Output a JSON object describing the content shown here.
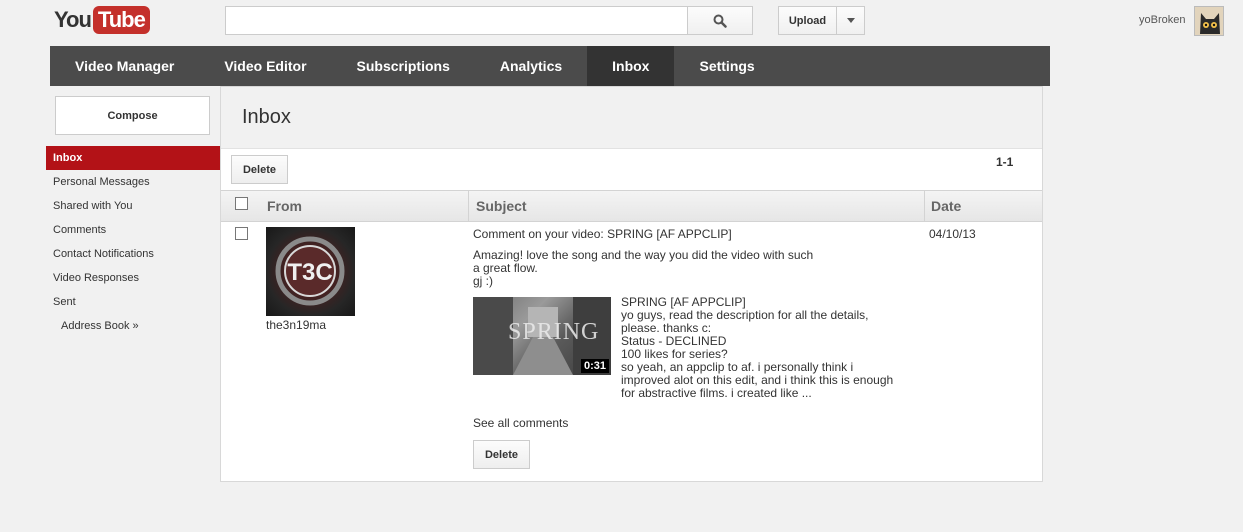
{
  "header": {
    "logo_you": "You",
    "logo_tube": "Tube",
    "search_value": "",
    "upload_label": "Upload",
    "username": "yoBroken",
    "search_icon": "search-icon",
    "dropdown_icon": "caret-down-icon"
  },
  "nav": {
    "items": [
      "Video Manager",
      "Video Editor",
      "Subscriptions",
      "Analytics",
      "Inbox",
      "Settings"
    ],
    "active": "Inbox"
  },
  "sidebar": {
    "compose_label": "Compose",
    "items": [
      "Inbox",
      "Personal Messages",
      "Shared with You",
      "Comments",
      "Contact Notifications",
      "Video Responses",
      "Sent",
      "Address Book »"
    ],
    "active": "Inbox"
  },
  "main": {
    "title": "Inbox",
    "delete_label": "Delete",
    "page_count": "1-1",
    "columns": {
      "from": "From",
      "subject": "Subject",
      "date": "Date"
    },
    "messages": [
      {
        "from": "the3n19ma",
        "avatar_text": "T3C",
        "subject": "Comment on your video: SPRING [AF APPCLIP]",
        "body": [
          "Amazing! love the song and the way you did the video with such",
          "a great flow.",
          "gj :)"
        ],
        "video": {
          "thumb_text": "SPRING",
          "duration": "0:31",
          "title": "SPRING [AF APPCLIP]",
          "description": [
            "yo guys, read the description for all the details,",
            "please. thanks c:",
            "Status - DECLINED",
            "100 likes for series?",
            "so yeah, an appclip to af. i personally think i",
            "improved alot on this edit, and i think this is enough",
            "for abstractive films. i created like ..."
          ]
        },
        "see_all": "See all comments",
        "delete_label": "Delete",
        "date": "04/10/13"
      }
    ]
  },
  "colors": {
    "nav_bg": "#4b4b4b",
    "nav_active": "#333333",
    "sidebar_active": "#b31217",
    "logo_red": "#c4302b"
  }
}
